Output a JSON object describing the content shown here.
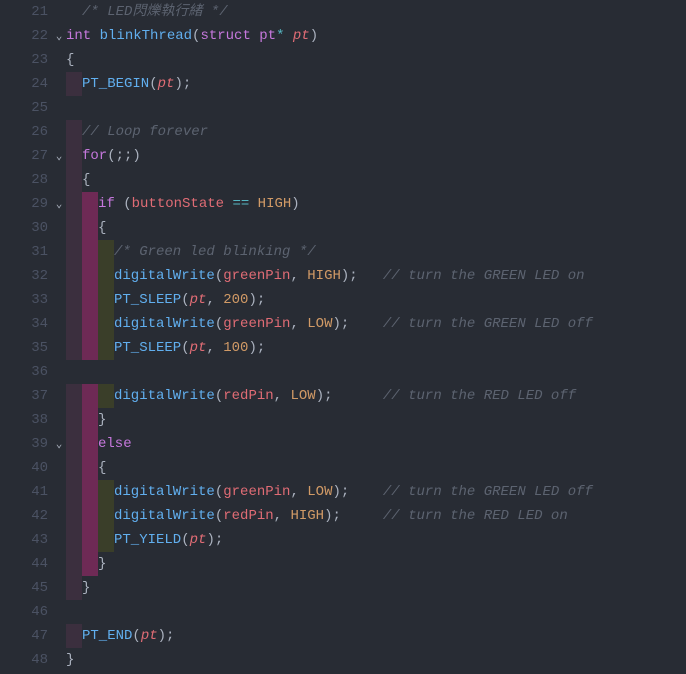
{
  "startLine": 21,
  "foldMarkers": {
    "22": "v",
    "27": "v",
    "29": "v",
    "39": "v"
  },
  "lines": [
    {
      "indent": [
        "plain"
      ],
      "tokens": [
        {
          "t": "/* LED閃爍執行緒 */",
          "c": "tk-comment"
        }
      ]
    },
    {
      "indent": [],
      "tokens": [
        {
          "t": "int ",
          "c": "tk-type"
        },
        {
          "t": "blinkThread",
          "c": "tk-funcname"
        },
        {
          "t": "(",
          "c": "tk-punct"
        },
        {
          "t": "struct ",
          "c": "tk-keyword"
        },
        {
          "t": "pt",
          "c": "tk-type"
        },
        {
          "t": "* ",
          "c": "tk-op"
        },
        {
          "t": "pt",
          "c": "tk-param"
        },
        {
          "t": ")",
          "c": "tk-punct"
        }
      ]
    },
    {
      "indent": [],
      "tokens": [
        {
          "t": "{",
          "c": "tk-punct"
        }
      ]
    },
    {
      "indent": [
        "bar0"
      ],
      "tokens": [
        {
          "t": "PT_BEGIN",
          "c": "tk-macro"
        },
        {
          "t": "(",
          "c": "tk-punct"
        },
        {
          "t": "pt",
          "c": "tk-param"
        },
        {
          "t": ");",
          "c": "tk-punct"
        }
      ]
    },
    {
      "indent": [],
      "tokens": []
    },
    {
      "indent": [
        "bar0"
      ],
      "tokens": [
        {
          "t": "// Loop forever",
          "c": "tk-comment"
        }
      ]
    },
    {
      "indent": [
        "bar0"
      ],
      "tokens": [
        {
          "t": "for",
          "c": "tk-keyword"
        },
        {
          "t": "(;;)",
          "c": "tk-punct"
        }
      ]
    },
    {
      "indent": [
        "bar0"
      ],
      "tokens": [
        {
          "t": "{",
          "c": "tk-punct"
        }
      ]
    },
    {
      "indent": [
        "bar0",
        "bar1"
      ],
      "tokens": [
        {
          "t": "if ",
          "c": "tk-keyword"
        },
        {
          "t": "(",
          "c": "tk-punct"
        },
        {
          "t": "buttonState ",
          "c": "tk-var"
        },
        {
          "t": "== ",
          "c": "tk-op"
        },
        {
          "t": "HIGH",
          "c": "tk-const"
        },
        {
          "t": ")",
          "c": "tk-punct"
        }
      ]
    },
    {
      "indent": [
        "bar0",
        "bar1"
      ],
      "tokens": [
        {
          "t": "{",
          "c": "tk-punct"
        }
      ]
    },
    {
      "indent": [
        "bar0",
        "bar1",
        "bar2"
      ],
      "tokens": [
        {
          "t": "/* Green led blinking */",
          "c": "tk-comment"
        }
      ]
    },
    {
      "indent": [
        "bar0",
        "bar1",
        "bar2"
      ],
      "tokens": [
        {
          "t": "digitalWrite",
          "c": "tk-funccall"
        },
        {
          "t": "(",
          "c": "tk-punct"
        },
        {
          "t": "greenPin",
          "c": "tk-var"
        },
        {
          "t": ", ",
          "c": "tk-punct"
        },
        {
          "t": "HIGH",
          "c": "tk-const"
        },
        {
          "t": ");   ",
          "c": "tk-punct"
        },
        {
          "t": "// turn the GREEN LED on",
          "c": "tk-comment"
        }
      ]
    },
    {
      "indent": [
        "bar0",
        "bar1",
        "bar2"
      ],
      "tokens": [
        {
          "t": "PT_SLEEP",
          "c": "tk-macro"
        },
        {
          "t": "(",
          "c": "tk-punct"
        },
        {
          "t": "pt",
          "c": "tk-param"
        },
        {
          "t": ", ",
          "c": "tk-punct"
        },
        {
          "t": "200",
          "c": "tk-num"
        },
        {
          "t": ");",
          "c": "tk-punct"
        }
      ]
    },
    {
      "indent": [
        "bar0",
        "bar1",
        "bar2"
      ],
      "tokens": [
        {
          "t": "digitalWrite",
          "c": "tk-funccall"
        },
        {
          "t": "(",
          "c": "tk-punct"
        },
        {
          "t": "greenPin",
          "c": "tk-var"
        },
        {
          "t": ", ",
          "c": "tk-punct"
        },
        {
          "t": "LOW",
          "c": "tk-const"
        },
        {
          "t": ");    ",
          "c": "tk-punct"
        },
        {
          "t": "// turn the GREEN LED off",
          "c": "tk-comment"
        }
      ]
    },
    {
      "indent": [
        "bar0",
        "bar1",
        "bar2"
      ],
      "tokens": [
        {
          "t": "PT_SLEEP",
          "c": "tk-macro"
        },
        {
          "t": "(",
          "c": "tk-punct"
        },
        {
          "t": "pt",
          "c": "tk-param"
        },
        {
          "t": ", ",
          "c": "tk-punct"
        },
        {
          "t": "100",
          "c": "tk-num"
        },
        {
          "t": ");",
          "c": "tk-punct"
        }
      ]
    },
    {
      "indent": [],
      "tokens": []
    },
    {
      "indent": [
        "bar0",
        "bar1",
        "bar2"
      ],
      "tokens": [
        {
          "t": "digitalWrite",
          "c": "tk-funccall"
        },
        {
          "t": "(",
          "c": "tk-punct"
        },
        {
          "t": "redPin",
          "c": "tk-var"
        },
        {
          "t": ", ",
          "c": "tk-punct"
        },
        {
          "t": "LOW",
          "c": "tk-const"
        },
        {
          "t": ");      ",
          "c": "tk-punct"
        },
        {
          "t": "// turn the RED LED off",
          "c": "tk-comment"
        }
      ]
    },
    {
      "indent": [
        "bar0",
        "bar1"
      ],
      "tokens": [
        {
          "t": "}",
          "c": "tk-punct"
        }
      ]
    },
    {
      "indent": [
        "bar0",
        "bar1"
      ],
      "tokens": [
        {
          "t": "else",
          "c": "tk-keyword"
        }
      ]
    },
    {
      "indent": [
        "bar0",
        "bar1"
      ],
      "tokens": [
        {
          "t": "{",
          "c": "tk-punct"
        }
      ]
    },
    {
      "indent": [
        "bar0",
        "bar1",
        "bar2"
      ],
      "tokens": [
        {
          "t": "digitalWrite",
          "c": "tk-funccall"
        },
        {
          "t": "(",
          "c": "tk-punct"
        },
        {
          "t": "greenPin",
          "c": "tk-var"
        },
        {
          "t": ", ",
          "c": "tk-punct"
        },
        {
          "t": "LOW",
          "c": "tk-const"
        },
        {
          "t": ");    ",
          "c": "tk-punct"
        },
        {
          "t": "// turn the GREEN LED off",
          "c": "tk-comment"
        }
      ]
    },
    {
      "indent": [
        "bar0",
        "bar1",
        "bar2"
      ],
      "tokens": [
        {
          "t": "digitalWrite",
          "c": "tk-funccall"
        },
        {
          "t": "(",
          "c": "tk-punct"
        },
        {
          "t": "redPin",
          "c": "tk-var"
        },
        {
          "t": ", ",
          "c": "tk-punct"
        },
        {
          "t": "HIGH",
          "c": "tk-const"
        },
        {
          "t": ");     ",
          "c": "tk-punct"
        },
        {
          "t": "// turn the RED LED on",
          "c": "tk-comment"
        }
      ]
    },
    {
      "indent": [
        "bar0",
        "bar1",
        "bar2"
      ],
      "tokens": [
        {
          "t": "PT_YIELD",
          "c": "tk-macro"
        },
        {
          "t": "(",
          "c": "tk-punct"
        },
        {
          "t": "pt",
          "c": "tk-param"
        },
        {
          "t": ");",
          "c": "tk-punct"
        }
      ]
    },
    {
      "indent": [
        "bar0",
        "bar1"
      ],
      "tokens": [
        {
          "t": "}",
          "c": "tk-punct"
        }
      ]
    },
    {
      "indent": [
        "bar0"
      ],
      "tokens": [
        {
          "t": "}",
          "c": "tk-punct"
        }
      ]
    },
    {
      "indent": [],
      "tokens": []
    },
    {
      "indent": [
        "bar0"
      ],
      "tokens": [
        {
          "t": "PT_END",
          "c": "tk-macro"
        },
        {
          "t": "(",
          "c": "tk-punct"
        },
        {
          "t": "pt",
          "c": "tk-param"
        },
        {
          "t": ");",
          "c": "tk-punct"
        }
      ]
    },
    {
      "indent": [],
      "tokens": [
        {
          "t": "}",
          "c": "tk-punct"
        }
      ]
    }
  ]
}
